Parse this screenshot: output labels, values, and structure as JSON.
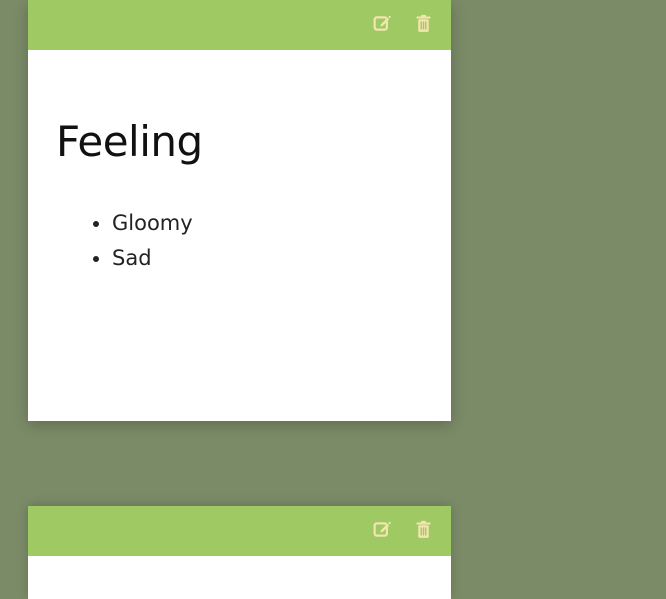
{
  "colors": {
    "background": "#7b8b67",
    "toolbar": "#9fc963",
    "icon": "#f4e5b0",
    "card": "#ffffff"
  },
  "notes": [
    {
      "title": "Feeling",
      "items": [
        "Gloomy",
        "Sad"
      ],
      "actions": {
        "edit_icon": "edit-icon",
        "delete_icon": "trash-icon"
      }
    },
    {
      "title": "",
      "items": [],
      "actions": {
        "edit_icon": "edit-icon",
        "delete_icon": "trash-icon"
      }
    }
  ]
}
